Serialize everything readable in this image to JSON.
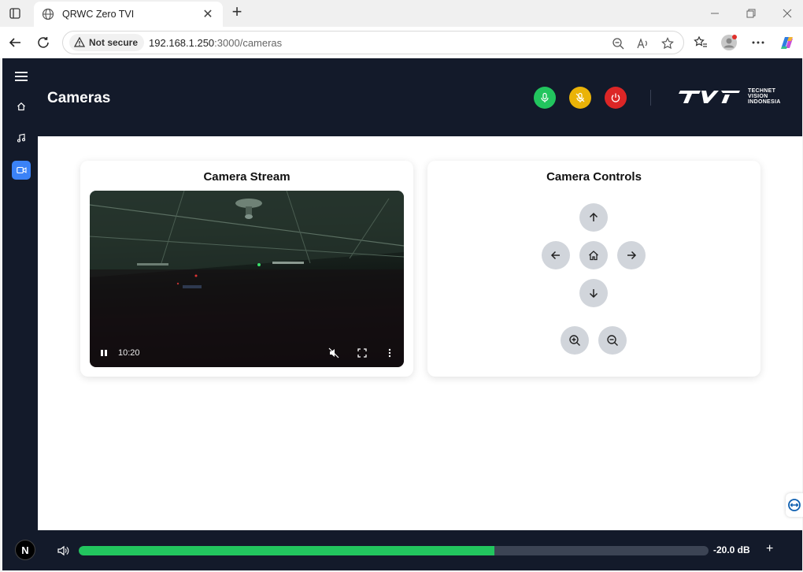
{
  "browser": {
    "tab_title": "QRWC Zero TVI",
    "security_label": "Not secure",
    "url_host": "192.168.1.250",
    "url_path": ":3000/cameras"
  },
  "app": {
    "page_title": "Cameras",
    "sidebar": [
      "menu-icon",
      "home-icon",
      "music-icon",
      "video-camera-icon"
    ],
    "header_buttons": [
      {
        "name": "mic-on-button",
        "color": "#22c55e"
      },
      {
        "name": "mic-off-button",
        "color": "#eab308"
      },
      {
        "name": "power-button",
        "color": "#dc2626"
      }
    ],
    "logo": {
      "lines": [
        "TECHNET",
        "VISION",
        "INDONESIA"
      ]
    }
  },
  "stream_card": {
    "title": "Camera Stream",
    "time": "10:20"
  },
  "controls_card": {
    "title": "Camera Controls"
  },
  "bottom": {
    "badge": "N",
    "volume_level": 0.66,
    "volume_text": "-20.0 dB",
    "plus": "+"
  },
  "colors": {
    "accent": "#3b82f6",
    "app_bg": "#131a2a",
    "volume_fill": "#22c55e"
  }
}
